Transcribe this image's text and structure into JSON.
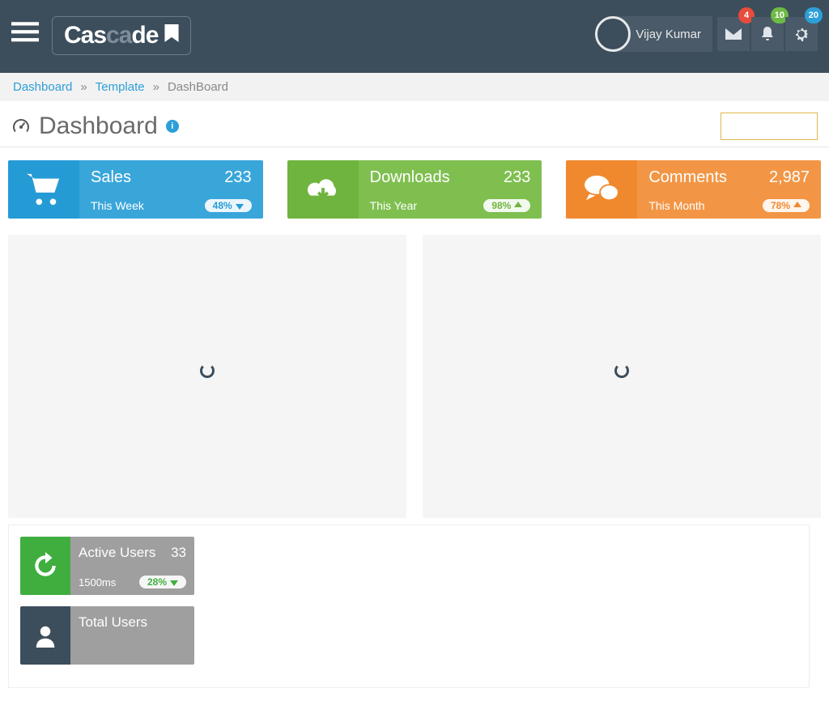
{
  "brand": {
    "seg1": "Cas",
    "seg2": "ca",
    "seg3": "de"
  },
  "user": {
    "name": "Vijay Kumar"
  },
  "badges": {
    "mail": "4",
    "bell": "10",
    "gear": "20"
  },
  "breadcrumb": {
    "root": "Dashboard",
    "mid": "Template",
    "current": "DashBoard"
  },
  "page": {
    "title": "Dashboard"
  },
  "cards": {
    "sales": {
      "label": "Sales",
      "value": "233",
      "period": "This Week",
      "pct": "48%",
      "dir": "down"
    },
    "downloads": {
      "label": "Downloads",
      "value": "233",
      "period": "This Year",
      "pct": "98%",
      "dir": "up"
    },
    "comments": {
      "label": "Comments",
      "value": "2,987",
      "period": "This Month",
      "pct": "78%",
      "dir": "up"
    }
  },
  "small": {
    "active": {
      "label": "Active Users",
      "value": "33",
      "period": "1500ms",
      "pct": "28%",
      "dir": "down"
    },
    "total": {
      "label": "Total Users"
    }
  }
}
